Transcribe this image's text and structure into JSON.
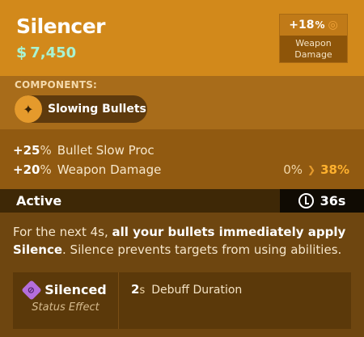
{
  "item": {
    "name": "Silencer",
    "price": "7,450",
    "currency_symbol": "$",
    "price_color": "#a8f3d2"
  },
  "weapon_damage_badge": {
    "value": "+18",
    "unit": "%",
    "icon": "weapon-damage-icon",
    "label": "Weapon Damage"
  },
  "components": {
    "title": "COMPONENTS:",
    "items": [
      {
        "label": "Slowing Bullets",
        "icon": "slowing-bullets-icon"
      }
    ]
  },
  "stats": [
    {
      "value": "+25",
      "unit": "%",
      "label": "Bullet Slow Proc"
    },
    {
      "value": "+20",
      "unit": "%",
      "label": "Weapon Damage",
      "compare_from": "0%",
      "compare_to": "38%"
    }
  ],
  "active": {
    "label": "Active",
    "cooldown": "36s",
    "cooldown_icon": "cooldown-clock-icon"
  },
  "description": {
    "part1": "For the next 4s, ",
    "bold1": "all your bullets immediately apply Silence",
    "part2": ". Silence prevents targets from using abilities."
  },
  "effect": {
    "name": "Silenced",
    "icon": "silenced-icon",
    "subtitle": "Status Effect",
    "duration_value": "2",
    "duration_unit": "s",
    "duration_label": "Debuff Duration"
  },
  "colors": {
    "header_bg": "#d2891b",
    "accent_orange": "#ffb12e",
    "silence_purple": "#b46edc"
  }
}
